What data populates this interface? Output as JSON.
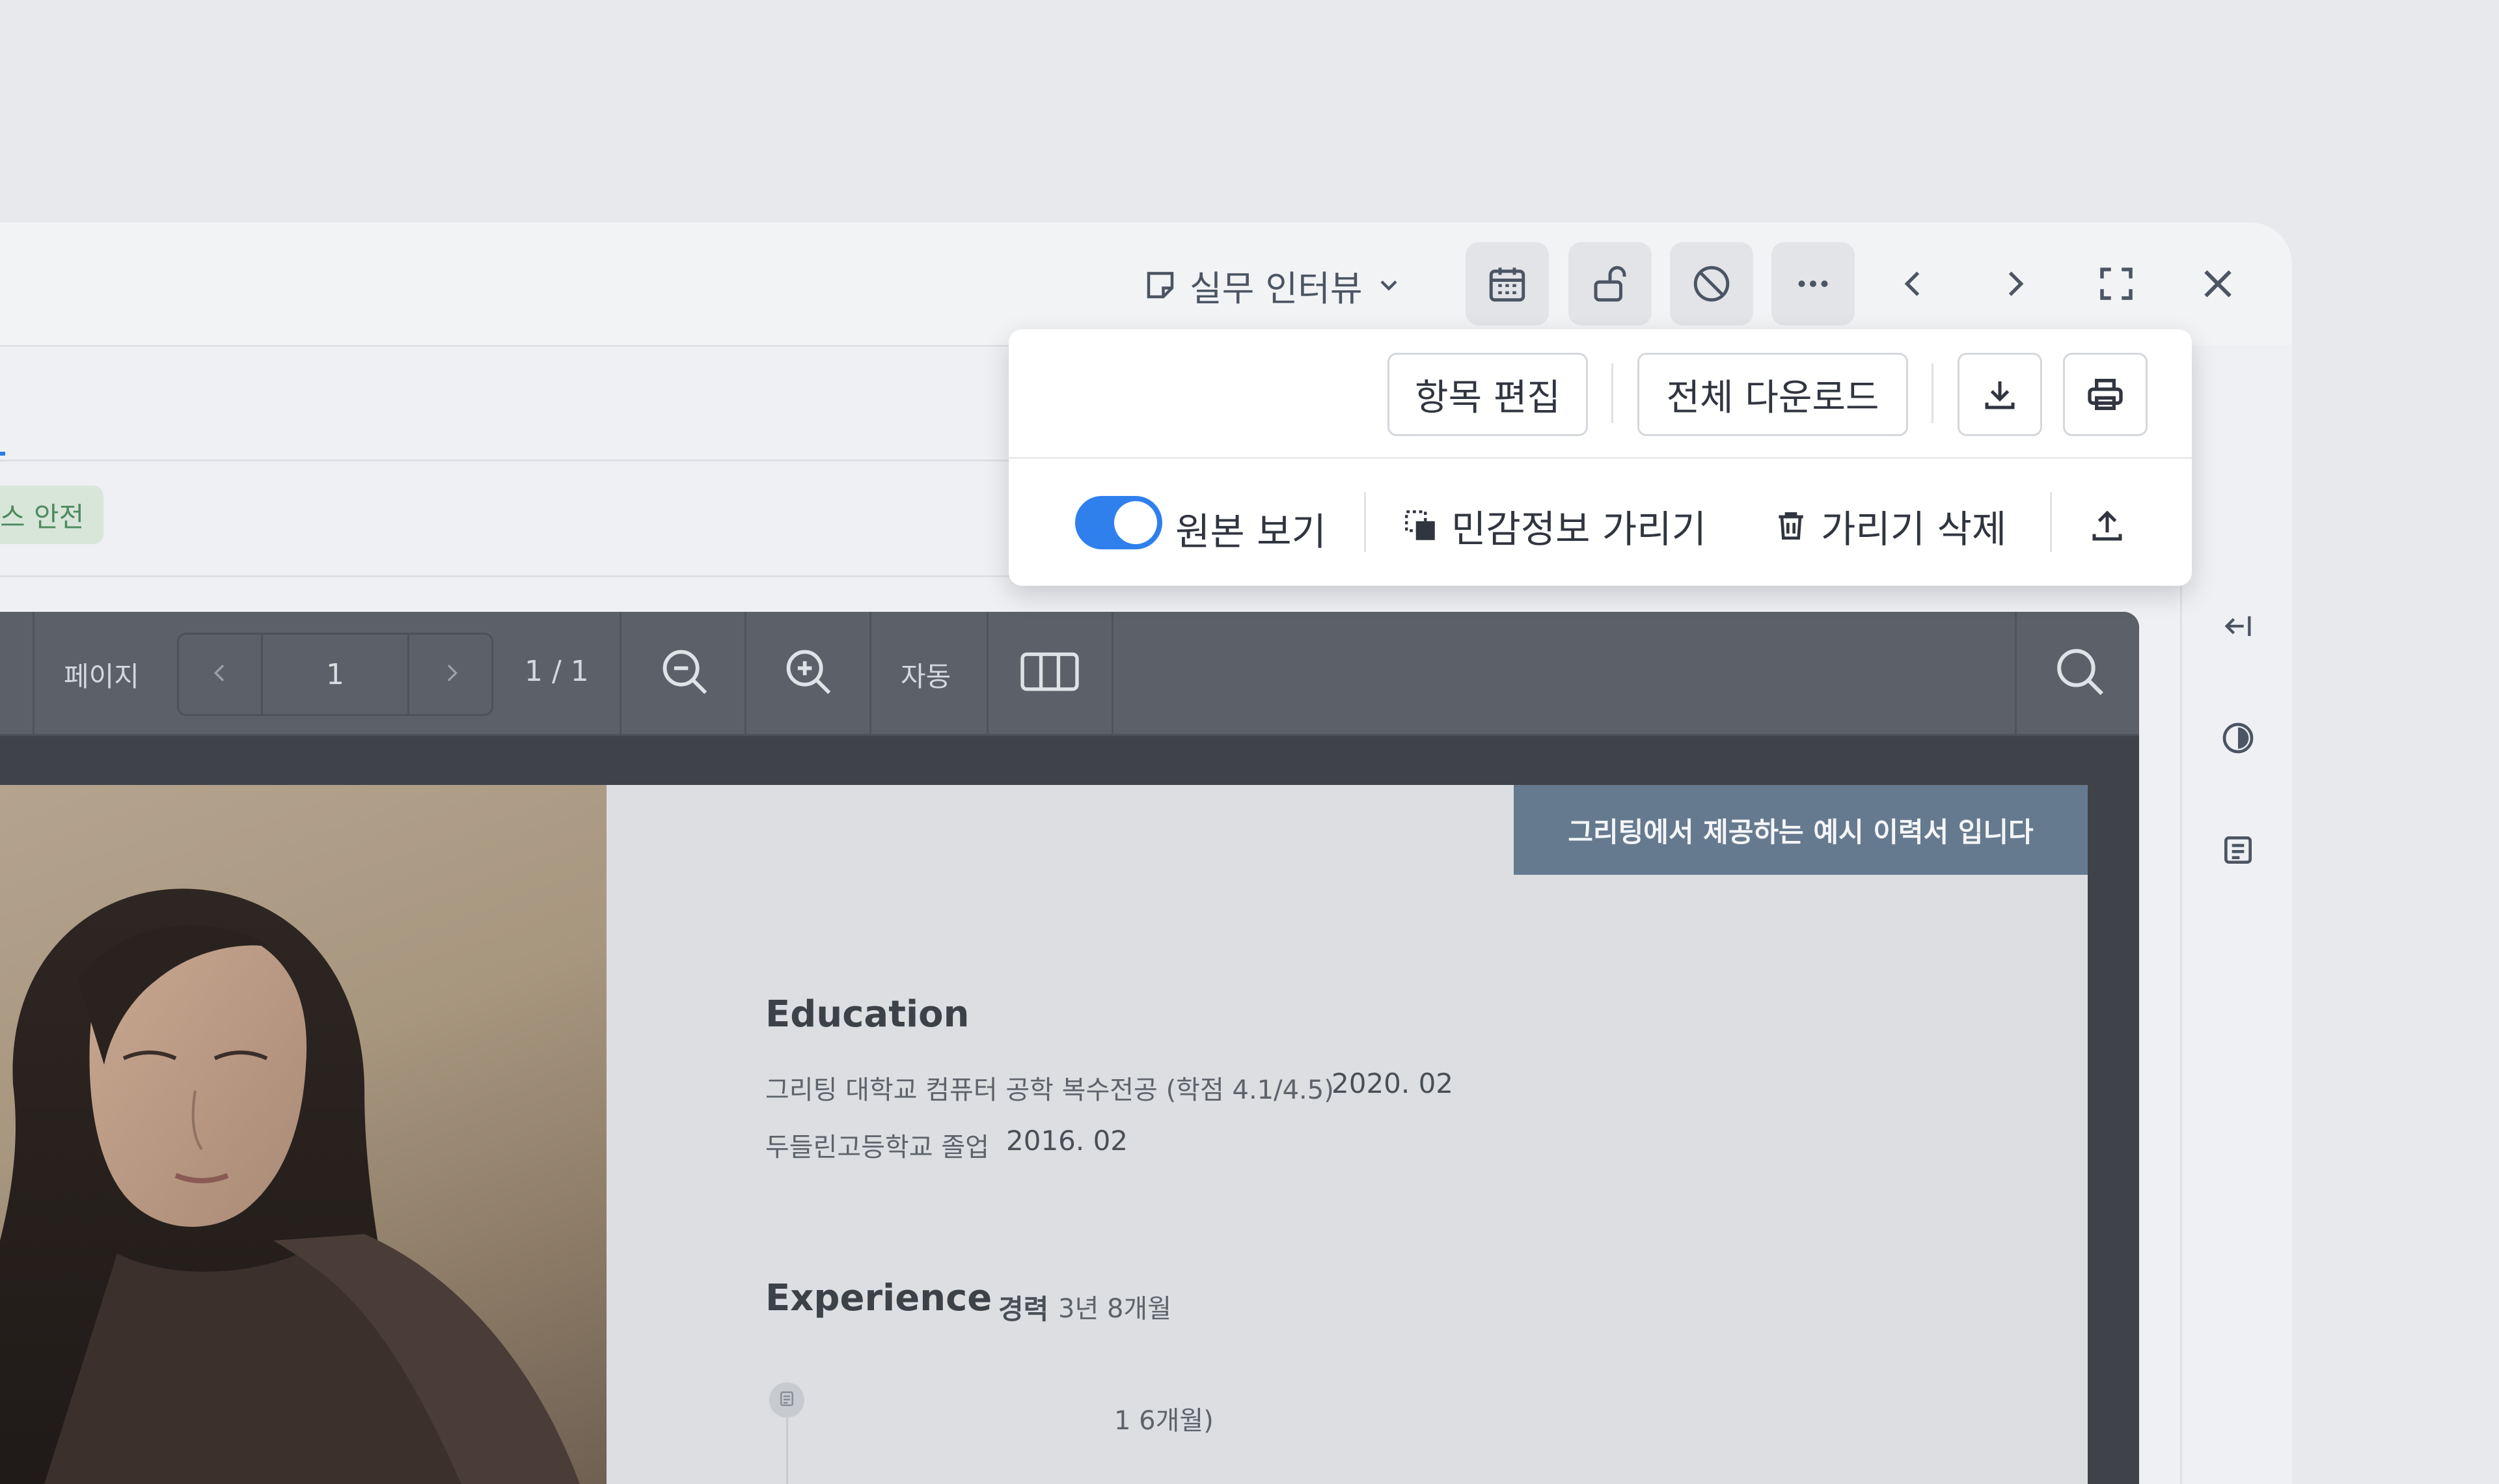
{
  "topbar": {
    "stage_title": "실무 인터뷰",
    "icons": [
      "memo-icon",
      "chevron-down-icon",
      "calendar-icon",
      "unlock-icon",
      "block-icon",
      "more-icon",
      "chevron-left-icon",
      "chevron-right-icon",
      "fullscreen-icon",
      "close-icon"
    ]
  },
  "tag": {
    "label": "스 안전",
    "color": "#d8e6da"
  },
  "popup": {
    "edit_items_label": "항목 편집",
    "download_all_label": "전체 다운로드",
    "original_view_label": "원본 보기",
    "original_view_on": true,
    "mask_sensitive_label": "민감정보 가리기",
    "delete_mask_label": "가리기 삭제"
  },
  "viewer": {
    "page_label": "페이지",
    "page_input_value": "1",
    "page_count": "1 / 1",
    "zoom_mode": "자동"
  },
  "document": {
    "banner": "그리팅에서 제공하는 예시 이력서 입니다",
    "education_title": "Education",
    "education_items": [
      {
        "name": "그리팅 대학교 컴퓨터 공학 복수전공 (학점 4.1/4.5)",
        "date": "2020. 02"
      },
      {
        "name": "두들린고등학교 졸업",
        "date": "2016. 02"
      }
    ],
    "experience_title": "Experience",
    "experience_label": "경력",
    "experience_duration": "3년 8개월",
    "partial_text": "1 6개월)"
  },
  "colors": {
    "accent": "#2f80ed",
    "banner": "#667a8f",
    "toolbar": "#5c6068"
  }
}
